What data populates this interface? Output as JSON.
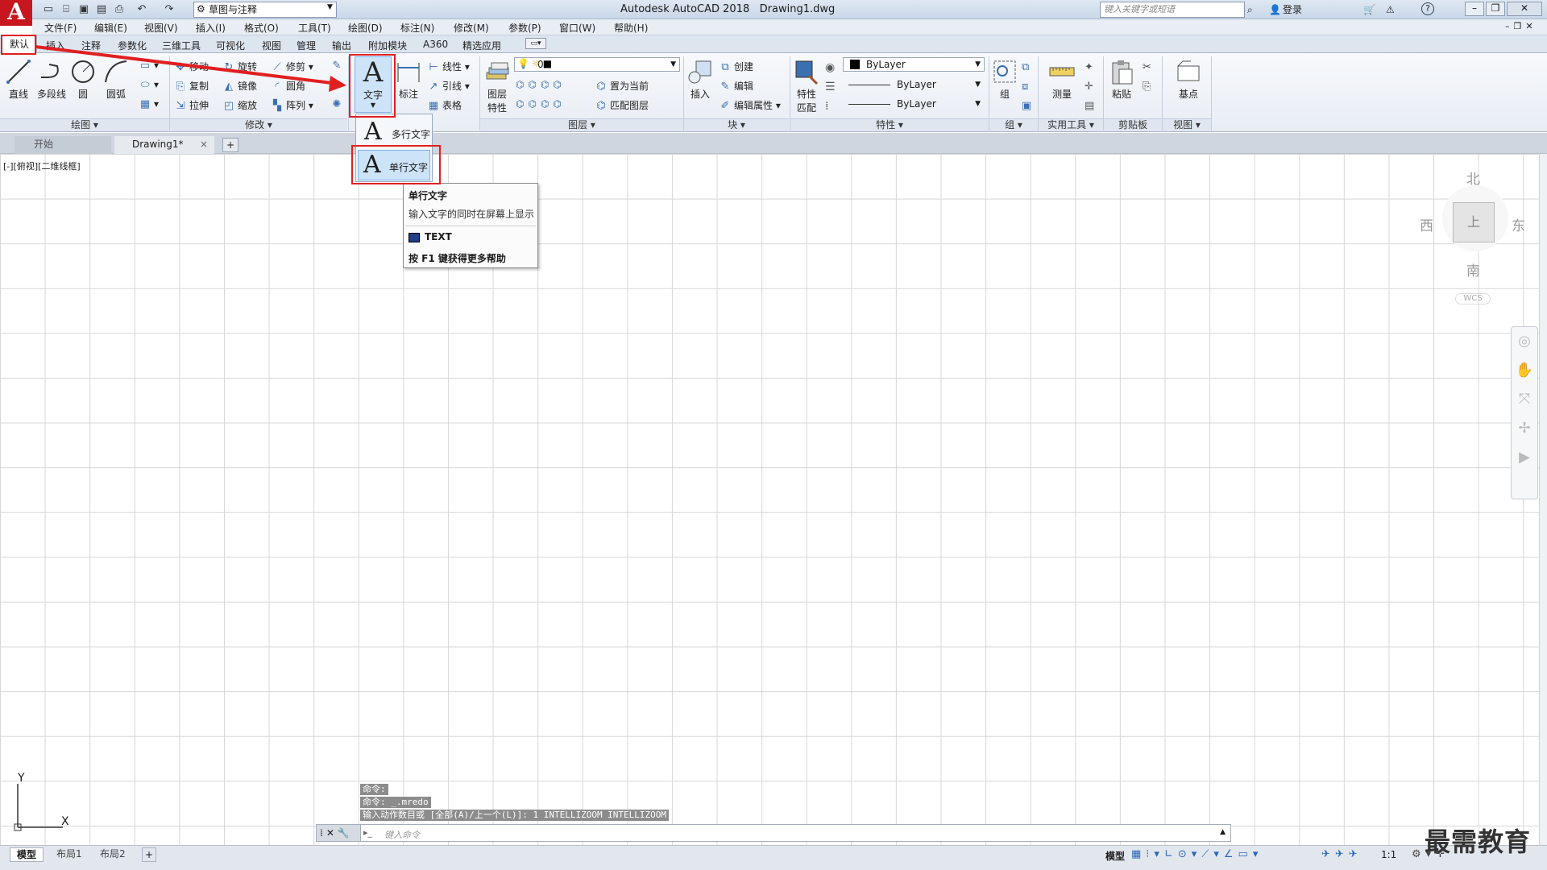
{
  "app": {
    "logo": "A",
    "workspace": "草图与注释",
    "title": "Autodesk AutoCAD 2018",
    "filename": "Drawing1.dwg",
    "search_placeholder": "键入关键字或短语",
    "login": "登录",
    "help": "?"
  },
  "menus": [
    "文件(F)",
    "编辑(E)",
    "视图(V)",
    "插入(I)",
    "格式(O)",
    "工具(T)",
    "绘图(D)",
    "标注(N)",
    "修改(M)",
    "参数(P)",
    "窗口(W)",
    "帮助(H)"
  ],
  "ribbon_tabs": [
    "默认",
    "插入",
    "注释",
    "参数化",
    "三维工具",
    "可视化",
    "视图",
    "管理",
    "输出",
    "附加模块",
    "A360",
    "精选应用"
  ],
  "panels": {
    "draw": {
      "title": "绘图",
      "line": "直线",
      "polyline": "多段线",
      "circle": "圆",
      "arc": "圆弧"
    },
    "modify": {
      "title": "修改",
      "move": "移动",
      "rotate": "旋转",
      "trim": "修剪",
      "copy": "复制",
      "mirror": "镜像",
      "fillet": "圆角",
      "stretch": "拉伸",
      "scale": "缩放",
      "array": "阵列"
    },
    "annotation": {
      "text": "文字",
      "dimension": "标注",
      "linear": "线性",
      "leader": "引线",
      "table": "表格"
    },
    "layers": {
      "title": "图层",
      "properties_line1": "图层",
      "properties_line2": "特性",
      "layer_value": "0",
      "make_current": "置为当前",
      "match_layer": "匹配图层"
    },
    "block": {
      "title": "块",
      "insert": "插入",
      "create": "创建",
      "edit": "编辑",
      "edit_attr": "编辑属性"
    },
    "properties": {
      "title": "特性",
      "match_line1": "特性",
      "match_line2": "匹配",
      "color": "ByLayer",
      "linetype": "ByLayer",
      "lineweight": "ByLayer"
    },
    "groups": {
      "title": "组",
      "group": "组"
    },
    "utilities": {
      "title": "实用工具",
      "measure": "测量"
    },
    "clipboard": {
      "title": "剪贴板",
      "paste": "粘贴"
    },
    "view": {
      "title": "视图",
      "base": "基点"
    }
  },
  "text_dropdown": {
    "mtext": "多行文字",
    "dtext": "单行文字"
  },
  "tooltip": {
    "title": "单行文字",
    "desc": "输入文字的同时在屏幕上显示",
    "command": "TEXT",
    "help": "按 F1 键获得更多帮助"
  },
  "doc_tabs": {
    "start": "开始",
    "drawing": "Drawing1*",
    "close": "×",
    "new": "+"
  },
  "viewport_label": "[-][俯视][二维线框]",
  "viewcube": {
    "north": "北",
    "south": "南",
    "east": "东",
    "west": "西",
    "top": "上",
    "wcs": "WCS"
  },
  "ucs": {
    "x": "X",
    "y": "Y"
  },
  "command_history": [
    "命令:",
    "命令: _.mredo",
    "输入动作数目或 [全部(A)/上一个(L)]: 1 INTELLIZOOM INTELLIZOOM"
  ],
  "command_placeholder": "键入命令",
  "layout_tabs": [
    "模型",
    "布局1",
    "布局2"
  ],
  "status": {
    "model": "模型",
    "scale": "1:1"
  },
  "watermark": "最需教育",
  "colors": {
    "highlight_red": "#e02020",
    "logo_red": "#c8161e",
    "ribbon_bg": "#eef2f7"
  }
}
